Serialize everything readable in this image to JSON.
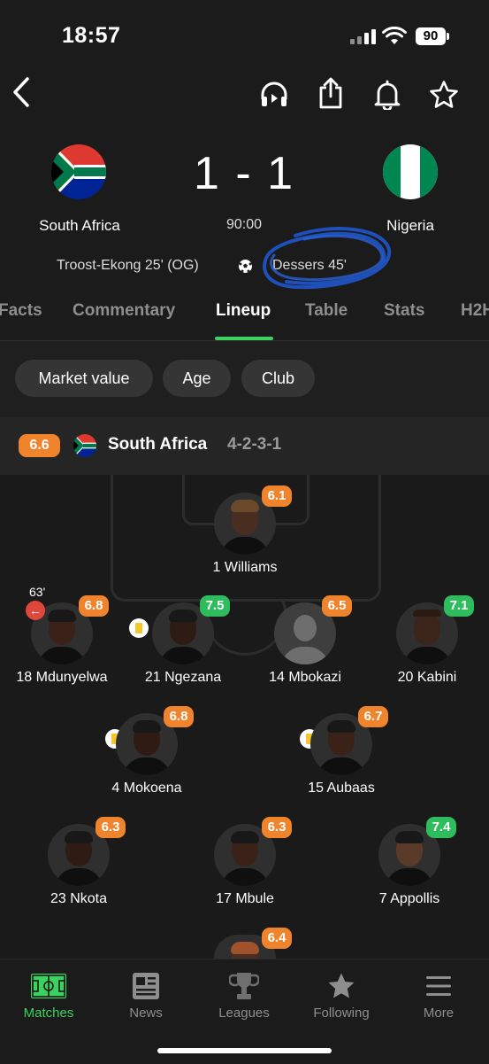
{
  "status_bar": {
    "time": "18:57",
    "battery": "90"
  },
  "top_actions": [
    "back",
    "audio",
    "share",
    "notifications",
    "favorite"
  ],
  "match": {
    "home_team": "South Africa",
    "away_team": "Nigeria",
    "score": "1 - 1",
    "time": "90:00",
    "home_scorer": "Troost-Ekong 25' (OG)",
    "away_scorer": "Dessers 45'"
  },
  "tabs": [
    "Facts",
    "Commentary",
    "Lineup",
    "Table",
    "Stats",
    "H2H"
  ],
  "active_tab": "Lineup",
  "filters": [
    "Market value",
    "Age",
    "Club"
  ],
  "team_header": {
    "rating": "6.6",
    "name": "South Africa",
    "formation": "4-2-3-1"
  },
  "players": [
    {
      "name": "1 Williams",
      "rating": "6.1"
    },
    {
      "name": "18 Mdunyelwa",
      "rating": "6.8",
      "sub_minute": "63'"
    },
    {
      "name": "21 Ngezana",
      "rating": "7.5"
    },
    {
      "name": "14 Mbokazi",
      "rating": "6.5"
    },
    {
      "name": "20 Kabini",
      "rating": "7.1"
    },
    {
      "name": "4 Mokoena",
      "rating": "6.8"
    },
    {
      "name": "15 Aubaas",
      "rating": "6.7"
    },
    {
      "name": "23 Nkota",
      "rating": "6.3"
    },
    {
      "name": "17 Mbule",
      "rating": "6.3"
    },
    {
      "name": "7 Appollis",
      "rating": "7.4"
    },
    {
      "name": "",
      "rating": "6.4"
    }
  ],
  "bottom_nav": [
    "Matches",
    "News",
    "Leagues",
    "Following",
    "More"
  ],
  "colors": {
    "accent_green": "#3dd15f",
    "rating_orange": "#f0842c",
    "rating_green": "#2fbc5c",
    "annotation_blue": "#1f55c8"
  }
}
